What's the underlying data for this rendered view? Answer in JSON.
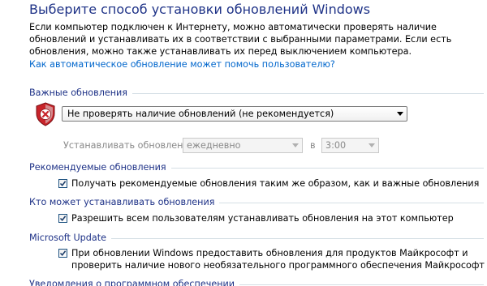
{
  "title": "Выберите способ установки обновлений Windows",
  "intro": "Если компьютер подключен к Интернету, можно автоматически проверять наличие обновлений и устанавливать их в соответствии с выбранными параметрами. Если есть обновления, можно также устанавливать их перед выключением компьютера.",
  "help_link": "Как автоматическое обновление может помочь пользователю?",
  "important": {
    "header": "Важные обновления",
    "selected_option": "Не проверять наличие обновлений (не рекомендуется)",
    "install_label": "Устанавливать обновления:",
    "frequency": "ежедневно",
    "at_label": "в",
    "time": "3:00"
  },
  "recommended": {
    "header": "Рекомендуемые обновления",
    "checkbox_label": "Получать рекомендуемые обновления таким же образом, как и важные обновления",
    "checked": true
  },
  "who": {
    "header": "Кто может устанавливать обновления",
    "checkbox_label": "Разрешить всем пользователям устанавливать обновления на этот компьютер",
    "checked": true
  },
  "microsoft_update": {
    "header": "Microsoft Update",
    "checkbox_label": "При обновлении Windows предоставить обновления для продуктов Майкрософт и проверить наличие нового необязательного программного обеспечения Майкрософт",
    "checked": true
  },
  "notifications": {
    "header": "Уведомления о программном обеспечении"
  },
  "colors": {
    "header_text": "#1e3287",
    "link": "#0066cc",
    "shield_red": "#c8242a"
  }
}
